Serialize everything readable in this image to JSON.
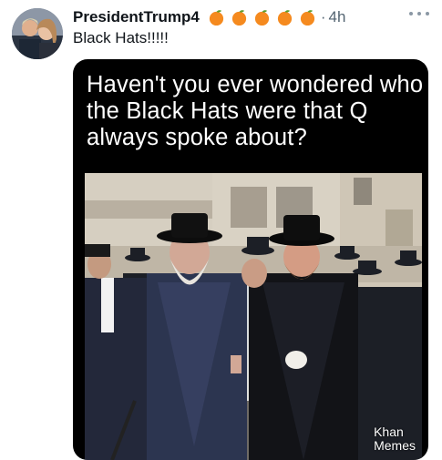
{
  "tweet": {
    "author_name": "PresidentTrump4",
    "name_emojis": [
      "orange-emoji",
      "orange-emoji",
      "orange-emoji",
      "orange-emoji",
      "orange-emoji"
    ],
    "separator": "·",
    "timestamp": "4h",
    "text": "Black Hats!!!!!",
    "more_icon": "more-dots-icon"
  },
  "media": {
    "caption": "Haven't you ever wondered who the Black Hats were that Q always spoke about?",
    "watermark_line1": "Khan",
    "watermark_line2": "Memes"
  },
  "colors": {
    "text_primary": "#0f1419",
    "text_secondary": "#536471",
    "media_background": "#000000",
    "emoji_orange": "#f58a1f"
  }
}
